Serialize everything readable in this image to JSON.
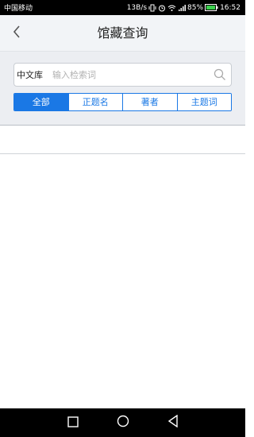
{
  "status_bar": {
    "carrier": "中国移动",
    "network_speed": "13B/s",
    "battery": "85%",
    "time": "16:52"
  },
  "header": {
    "title": "馆藏查询"
  },
  "search": {
    "library_label": "中文库",
    "placeholder": "输入检索词",
    "value": ""
  },
  "tabs": [
    {
      "label": "全部",
      "active": true
    },
    {
      "label": "正题名",
      "active": false
    },
    {
      "label": "著者",
      "active": false
    },
    {
      "label": "主题词",
      "active": false
    }
  ],
  "colors": {
    "accent": "#1a78e5",
    "header_bg": "#f2f4f7",
    "search_area_bg": "#eceef2"
  }
}
